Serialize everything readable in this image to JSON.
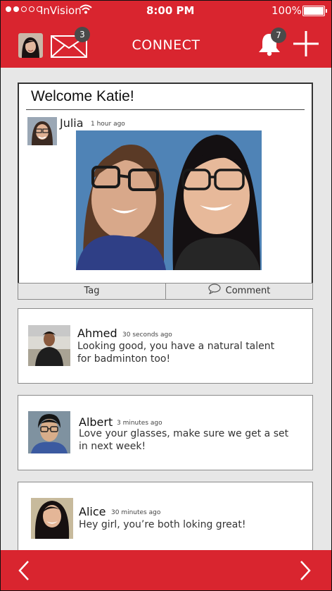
{
  "status": {
    "carrier": "InVision",
    "time": "8:00 PM",
    "battery": "100%"
  },
  "header": {
    "title": "CONNECT",
    "mail_count": "3",
    "notif_count": "7"
  },
  "post": {
    "welcome": "Welcome Katie!",
    "author": "Julia",
    "time": "1 hour ago",
    "tag_label": "Tag",
    "comment_label": "Comment"
  },
  "comments": [
    {
      "name": "Ahmed",
      "time": "30 seconds ago",
      "text": "Looking good, you have a natural talent for badminton too!"
    },
    {
      "name": "Albert",
      "time": "3 minutes ago",
      "text": "Love your glasses, make sure we get a set in next week!"
    },
    {
      "name": "Alice",
      "time": "30 minutes ago",
      "text": "Hey girl, you’re both loking great!"
    }
  ],
  "colors": {
    "brand": "#d9252f",
    "background": "#e7e7e7"
  }
}
